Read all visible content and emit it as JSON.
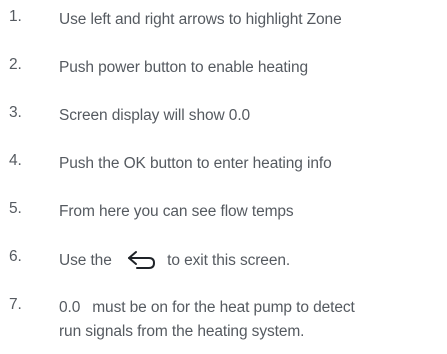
{
  "steps": [
    {
      "number": "1.",
      "text": "Use left and right arrows to highlight Zone"
    },
    {
      "number": "2.",
      "text": "Push power button to enable heating"
    },
    {
      "number": "3.",
      "text": "Screen display will show 0.0"
    },
    {
      "number": "4.",
      "text": "Push the OK button to enter heating info"
    },
    {
      "number": "5.",
      "text": "From here you can see flow temps"
    },
    {
      "number": "6.",
      "text_before": "Use the",
      "icon": "back-arrow-icon",
      "text_after": "to exit this screen."
    },
    {
      "number": "7.",
      "code": "0.0",
      "line1_rest": "must be on for the heat pump to detect",
      "line2": "run signals from the heating system."
    }
  ],
  "colors": {
    "text": "#555a60",
    "icon": "#1f2328",
    "background": "#ffffff"
  }
}
